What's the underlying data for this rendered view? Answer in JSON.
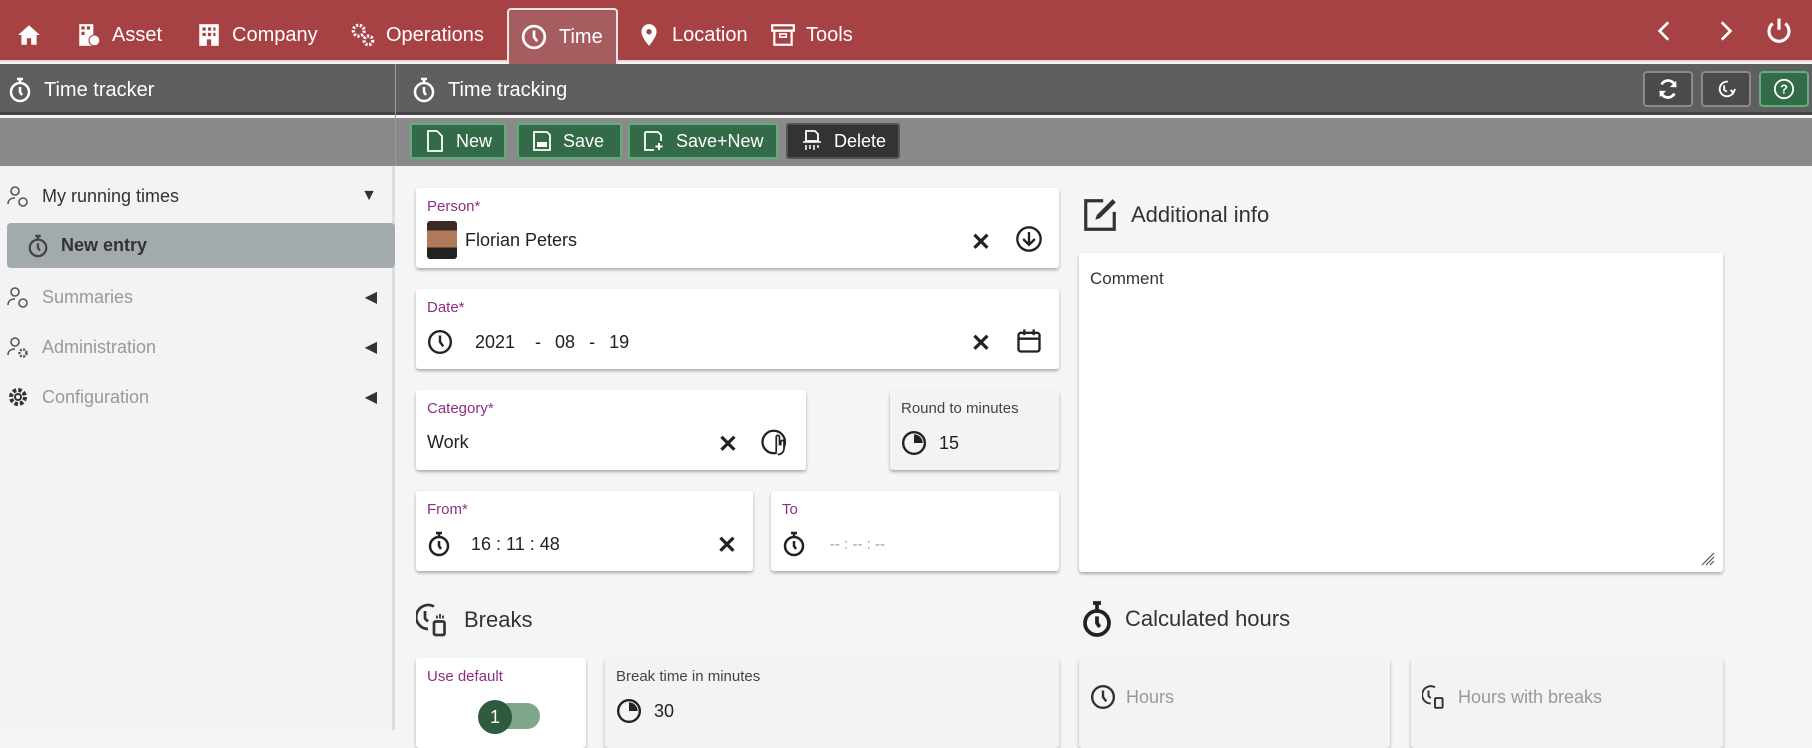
{
  "topnav": {
    "items": [
      {
        "label": "Asset"
      },
      {
        "label": "Company"
      },
      {
        "label": "Operations"
      },
      {
        "label": "Time"
      },
      {
        "label": "Location"
      },
      {
        "label": "Tools"
      }
    ]
  },
  "sidebar_header": {
    "title": "Time tracker"
  },
  "main_header": {
    "title": "Time tracking"
  },
  "toolbar": {
    "new": "New",
    "save": "Save",
    "save_new": "Save+New",
    "delete": "Delete"
  },
  "sidebar": {
    "items": [
      {
        "label": "My running times"
      },
      {
        "label": "New entry"
      },
      {
        "label": "Summaries"
      },
      {
        "label": "Administration"
      },
      {
        "label": "Configuration"
      }
    ]
  },
  "form": {
    "person": {
      "label": "Person*",
      "value": "Florian Peters"
    },
    "date": {
      "label": "Date*",
      "year": "2021",
      "month": "08",
      "day": "19",
      "sep": "-"
    },
    "category": {
      "label": "Category*",
      "value": "Work"
    },
    "round": {
      "label": "Round to minutes",
      "value": "15"
    },
    "from": {
      "label": "From*",
      "value": "16 : 11 : 48"
    },
    "to": {
      "label": "To",
      "value": "-- : -- : --"
    },
    "breaks": {
      "title": "Breaks",
      "use_default_label": "Use default",
      "toggle_value": "1",
      "break_label": "Break time in minutes",
      "break_value": "30"
    }
  },
  "additional": {
    "title": "Additional info",
    "comment_placeholder": "Comment"
  },
  "calculated": {
    "title": "Calculated hours",
    "hours": "Hours",
    "hours_breaks": "Hours with breaks"
  },
  "colors": {
    "brand": "#a64244",
    "accent": "#336a47",
    "label": "#8e2f84"
  }
}
